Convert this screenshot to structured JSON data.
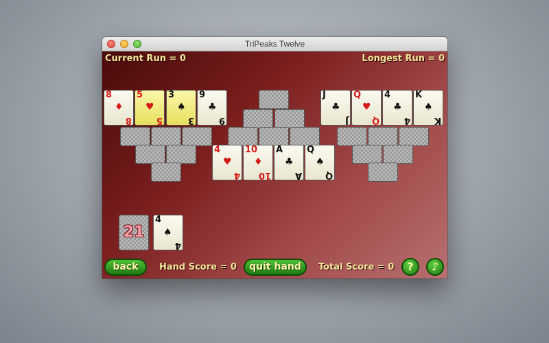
{
  "window": {
    "title": "TriPeaks Twelve"
  },
  "hud": {
    "current_run": "Current Run = 0",
    "longest_run": "Longest Run = 0",
    "hand_score": "Hand Score = 0",
    "total_score": "Total Score = 0"
  },
  "buttons": {
    "back": "back",
    "quit_hand": "quit hand",
    "help": "?",
    "music": "♪"
  },
  "stock": {
    "count": "21"
  },
  "waste": {
    "rank": "4",
    "suit": "♠",
    "color": "black"
  },
  "top_cards": [
    {
      "rank": "8",
      "suit": "♦",
      "color": "red",
      "highlight": false
    },
    {
      "rank": "5",
      "suit": "♥",
      "color": "red",
      "highlight": true
    },
    {
      "rank": "3",
      "suit": "♠",
      "color": "black",
      "highlight": true
    },
    {
      "rank": "9",
      "suit": "♣",
      "color": "black",
      "highlight": false
    },
    {
      "rank": "J",
      "suit": "♣",
      "color": "black",
      "highlight": false
    },
    {
      "rank": "Q",
      "suit": "♥",
      "color": "red",
      "highlight": false
    },
    {
      "rank": "4",
      "suit": "♣",
      "color": "black",
      "highlight": false
    },
    {
      "rank": "K",
      "suit": "♠",
      "color": "black",
      "highlight": false
    }
  ],
  "middle_cards": [
    {
      "rank": "4",
      "suit": "♥",
      "color": "red",
      "highlight": false
    },
    {
      "rank": "10",
      "suit": "♦",
      "color": "red",
      "highlight": false
    },
    {
      "rank": "A",
      "suit": "♣",
      "color": "black",
      "highlight": false
    },
    {
      "rank": "Q",
      "suit": "♠",
      "color": "black",
      "highlight": false
    }
  ]
}
